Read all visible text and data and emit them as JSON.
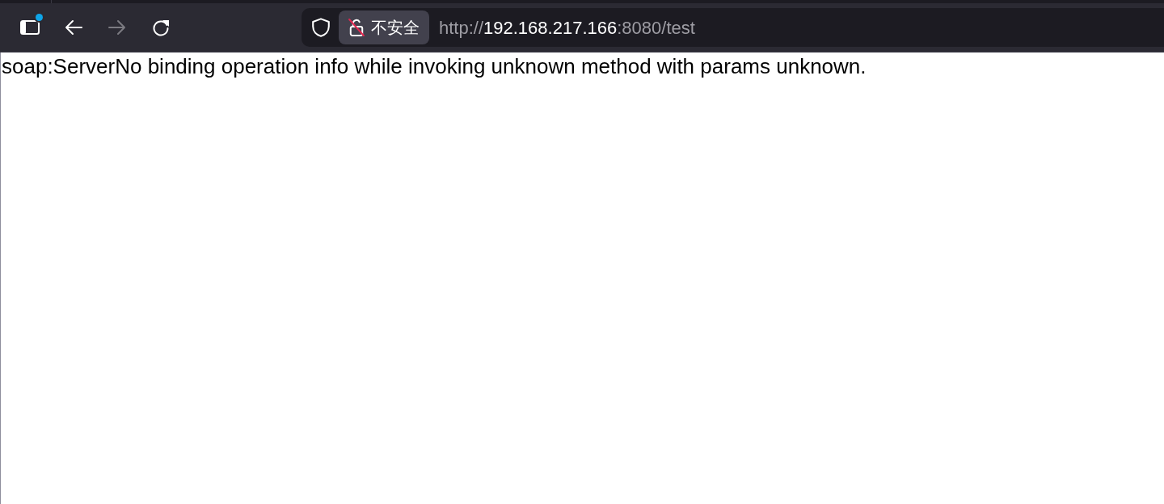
{
  "toolbar": {
    "buttons": [
      {
        "kind": "sidebar",
        "disabled": false,
        "notification": true
      },
      {
        "kind": "back",
        "disabled": false,
        "notification": false
      },
      {
        "kind": "forward",
        "disabled": true,
        "notification": false
      },
      {
        "kind": "reload",
        "disabled": false,
        "notification": false
      }
    ]
  },
  "address_bar": {
    "security_label": "不安全",
    "url": [
      {
        "text": "http://",
        "highlighted": false
      },
      {
        "text": "192.168.217.166",
        "highlighted": true
      },
      {
        "text": ":8080/test",
        "highlighted": false
      }
    ]
  },
  "page": {
    "message": "soap:ServerNo binding operation info while invoking unknown method with params unknown."
  }
}
